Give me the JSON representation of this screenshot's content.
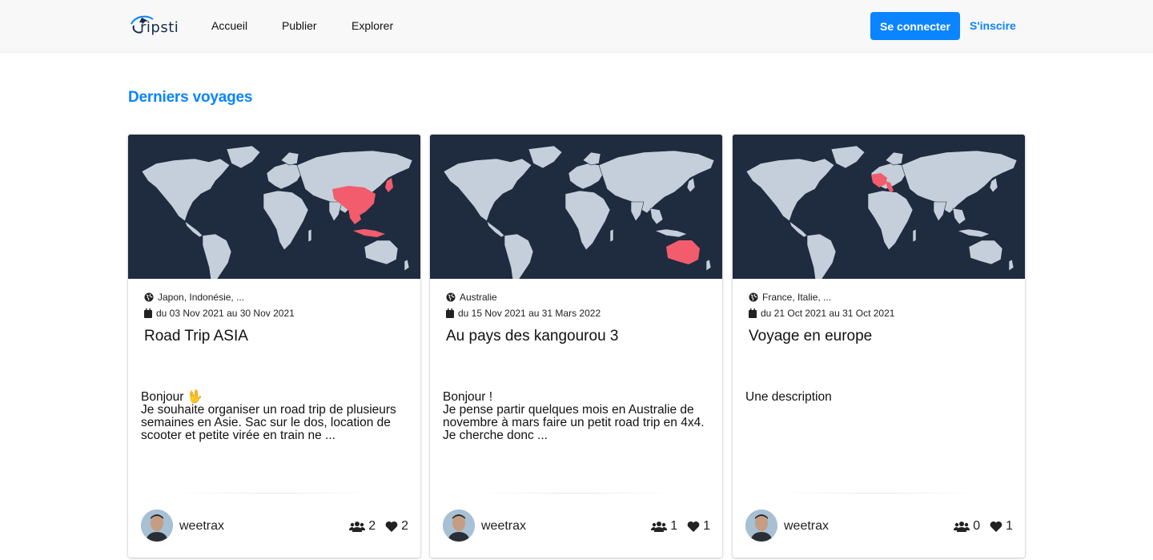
{
  "brand": {
    "name": "ripsti"
  },
  "nav": {
    "links": [
      "Accueil",
      "Publier",
      "Explorer"
    ],
    "login_label": "Se connecter",
    "signup_label": "S'inscire"
  },
  "section_title": "Derniers voyages",
  "colors": {
    "accent": "#0a84ff",
    "map_bg": "#1f2b3e",
    "land": "#c5cfdb",
    "highlight": "#f25c6c"
  },
  "cards": [
    {
      "countries": "Japon, Indonésie, ...",
      "dates": "du 03 Nov 2021 au 30 Nov 2021",
      "title": "Road Trip ASIA",
      "description": [
        "Bonjour 🖖",
        "Je souhaite organiser un road trip de plusieurs semaines en Asie. Sac sur le dos, location de scooter et petite virée en train ne ..."
      ],
      "highlight_region": "asia",
      "username": "weetrax",
      "participants": "2",
      "likes": "2"
    },
    {
      "countries": "Australie",
      "dates": "du 15 Nov 2021 au 31 Mars 2022",
      "title": "Au pays des kangourou 3",
      "description": [
        "Bonjour !",
        "Je pense partir quelques mois en Australie de novembre à mars faire un petit road trip en 4x4.",
        "Je cherche donc ..."
      ],
      "highlight_region": "australia",
      "username": "weetrax",
      "participants": "1",
      "likes": "1"
    },
    {
      "countries": "France, Italie, ...",
      "dates": "du 21 Oct 2021 au 31 Oct 2021",
      "title": "Voyage en europe",
      "description": [
        "Une description"
      ],
      "highlight_region": "europe",
      "username": "weetrax",
      "participants": "0",
      "likes": "1"
    }
  ],
  "icons": {
    "globe": "globe-icon",
    "calendar": "calendar-icon",
    "participants": "users-icon",
    "likes": "heart-icon"
  }
}
